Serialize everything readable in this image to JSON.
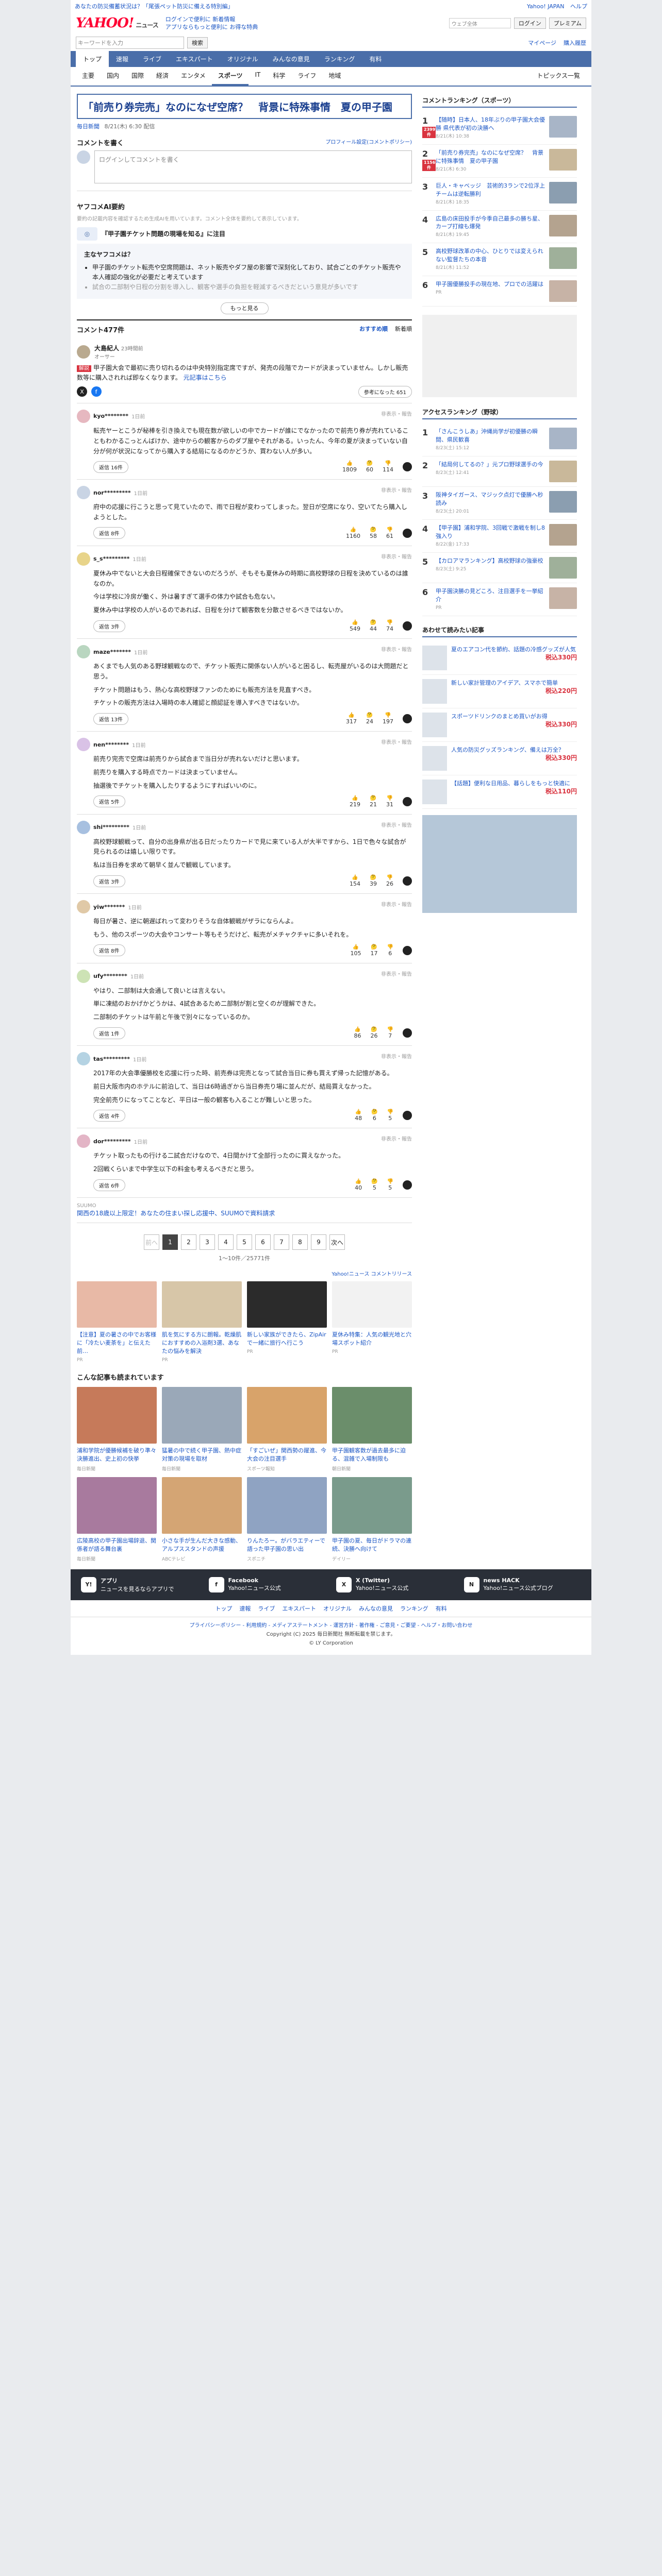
{
  "topbar": {
    "left": "あなたの防災備蓄状況は？「尾張ペット防災に備える特別編」",
    "right_links": [
      "Yahoo! JAPAN",
      "ヘルプ"
    ]
  },
  "header": {
    "logo": "YAHOO!",
    "logo_sub": "ニュース",
    "promo": [
      "ログインで便利に 新着情報",
      "アプリならもっと便利に お得な特典"
    ],
    "search_placeholder": "ウェブ全体",
    "search_button": "ログイン",
    "premium": "プレミアム"
  },
  "search": {
    "placeholder": "キーワードを入力",
    "button": "検索",
    "right": [
      "マイページ",
      "購入履歴"
    ]
  },
  "gnav": [
    "トップ",
    "速報",
    "ライブ",
    "エキスパート",
    "オリジナル",
    "みんなの意見",
    "ランキング",
    "有料"
  ],
  "subnav": [
    "主要",
    "国内",
    "国際",
    "経済",
    "エンタメ",
    "スポーツ",
    "IT",
    "科学",
    "ライフ",
    "地域"
  ],
  "subnav_right": "トピックス一覧",
  "article": {
    "title": "「前売り券完売」なのになぜ空席？　背景に特殊事情　夏の甲子園",
    "source": "毎日新聞",
    "date": "8/21(木) 6:30 配信"
  },
  "compose": {
    "title": "コメントを書く",
    "link": "プロフィール設定(コメントポリシー)",
    "placeholder": "ログインしてコメントを書く"
  },
  "ai": {
    "title": "ヤフコメAI要約",
    "note": "要約の記載内容を確認するため生成AIを用いています。コメント全体を要約して表示しています。",
    "question": "『甲子園チケット問題の現場を知る』に注目",
    "box_title": "主なヤフコメは？",
    "points": [
      "甲子園のチケット転売や空席問題は、ネット販売やダフ屋の影響で深刻化しており、試合ごとのチケット販売や本人確認の強化が必要だと考えています",
      "試合の二部制や日程の分割を導入し、観客や選手の負担を軽減するべきだという意見が多いです"
    ],
    "more": "もっと見る"
  },
  "comments_head": {
    "title": "コメント477件",
    "sort_label": "おすすめ順",
    "sort_alt": "新着順"
  },
  "expert": {
    "name": "大島紀人",
    "role": "オーサー",
    "time": "23時間前",
    "tag": "解説",
    "body": "甲子園大会で最初に売り切れるのは中央特別指定席ですが、発売の段階でカードが決まっていません。しかし販売数等に購入されれば即なくなります。",
    "link": "元記事はこちら",
    "likes": "参考になった 651"
  },
  "comments": [
    {
      "user": "kyo********",
      "time": "1日前",
      "action": "非表示・報告",
      "text": [
        "転売ヤーとこうが秘棒を引き換えでも現在数が欲しいの中でカードが誰にでなかったので前売り券が売れていることもわかるこっとんばけか、途中からの観客からのダブ屋やそれがある。いったん、今年の夏が決まっていない自分が何が状況になってから購入する結局になるのかどうか、買わない人が多い。"
      ],
      "reply": "返信 16件",
      "votes": [
        "1809",
        "60",
        "114"
      ]
    },
    {
      "user": "nor*********",
      "time": "1日前",
      "action": "非表示・報告",
      "text": [
        "府中の応援に行こうと思って見ていたので、雨で日程が変わってしまった。翌日が空席になり、空いてたら購入しようとした。"
      ],
      "reply": "返信 8件",
      "votes": [
        "1160",
        "58",
        "61"
      ]
    },
    {
      "user": "s_s*********",
      "time": "1日前",
      "action": "非表示・報告",
      "text": [
        "夏休み中でないと大会日程確保できないのだろうが、そもそも夏休みの時期に高校野球の日程を決めているのは誰なのか。",
        "今は学校に冷房が働く、外は暑すぎて選手の体力や試合も危ない。",
        "夏休み中は学校の人がいるのであれば、日程を分けて観客数を分散させるべきではないか。"
      ],
      "reply": "返信 3件",
      "votes": [
        "549",
        "44",
        "74"
      ]
    },
    {
      "user": "maze*******",
      "time": "1日前",
      "action": "非表示・報告",
      "text": [
        "あくまでも人気のある野球観戦なので、チケット販売に関係ない人がいると困るし、転売屋がいるのは大問題だと思う。",
        "チケット問題はもう、熱心な高校野球ファンのためにも販売方法を見直すべき。",
        "チケットの販売方法は入場時の本人確認と顔認証を導入すべきではないか。"
      ],
      "reply": "返信 13件",
      "votes": [
        "317",
        "24",
        "197"
      ]
    },
    {
      "user": "nen********",
      "time": "1日前",
      "action": "非表示・報告",
      "text": [
        "前売り完売で空席は前売りから試合まで当日分が売れないだけと思います。",
        "前売りを購入する時点でカードは決まっていません。",
        "抽選後でチケットを購入したりするようにすればいいのに。"
      ],
      "reply": "返信 5件",
      "votes": [
        "219",
        "21",
        "31"
      ]
    },
    {
      "user": "shi*********",
      "time": "1日前",
      "action": "非表示・報告",
      "text": [
        "高校野球観戦って、自分の出身県が出る日だったりカードで見に来ている人が大半ですから、1日で色々な試合が見られるのは嬉しい限りです。",
        "私は当日券を求めて朝早く並んで観戦しています。"
      ],
      "reply": "返信 3件",
      "votes": [
        "154",
        "39",
        "26"
      ]
    },
    {
      "user": "yiw*******",
      "time": "1日前",
      "action": "非表示・報告",
      "text": [
        "毎日が暑さ、逆に朝遅ばれって変わりそうな自体観戦がザラにならんよ。",
        "もう、他のスポーツの大会やコンサート等もそうだけど、転売がメチャクチャに多いそれを。"
      ],
      "reply": "返信 8件",
      "votes": [
        "105",
        "17",
        "6"
      ]
    },
    {
      "user": "ufy********",
      "time": "1日前",
      "action": "非表示・報告",
      "text": [
        "やはり、二部制は大会通して良いとは言えない。",
        "単に凍結のおかげかどうかは、4試合あるため二部制が割と空くのが理解できた。",
        "二部制のチケットは午前と午後で別々になっているのか。"
      ],
      "reply": "返信 1件",
      "votes": [
        "86",
        "26",
        "7"
      ]
    },
    {
      "user": "tas*********",
      "time": "1日前",
      "action": "非表示・報告",
      "text": [
        "2017年の大会準優勝校を応援に行った時、前売券は完売となって試合当日に券も買えず帰った記憶がある。",
        "前日大阪市内のホテルに前泊して、当日は6時過ぎから当日券売り場に並んだが、結局買えなかった。",
        "完全前売りになってことなど、平日は一般の観客も入ることが難しいと思った。"
      ],
      "reply": "返信 4件",
      "votes": [
        "48",
        "6",
        "5"
      ]
    },
    {
      "user": "dor*********",
      "time": "1日前",
      "action": "非表示・報告",
      "text": [
        "チケット取ったもの行ける二試合だけなので、4日間かけて全部行ったのに買えなかった。",
        "2回戦くらいまで中学生以下の料金も考えるべきだと思う。"
      ],
      "reply": "返信 6件",
      "votes": [
        "40",
        "5",
        "5"
      ]
    }
  ],
  "ad_inline": {
    "label": "SUUMO",
    "text": "関西の18歳以上限定！あなたの住まい探し応援中、SUUMOで資料請求"
  },
  "pager": {
    "prev": "前へ",
    "pages": [
      "1",
      "2",
      "3",
      "4",
      "5",
      "6",
      "7",
      "8",
      "9"
    ],
    "next": "次へ",
    "info": "1〜10件／25771件"
  },
  "ad_head": "Yahoo!ニュース コメントリリース",
  "ad_cards": [
    {
      "t": "【注意】夏の暑さの中でお客様に「冷たい麦茶を」と伝えた前…",
      "s": "PR"
    },
    {
      "t": "肌を気にする方に朗報。乾燥肌におすすめの入浴剤3選、あなたの悩みを解決",
      "s": "PR"
    },
    {
      "t": "新しい家族ができたら、ZipAirで一緒に旅行へ行こう",
      "s": "PR"
    },
    {
      "t": "夏休み特集：人気の観光地と穴場スポット紹介",
      "s": "PR"
    }
  ],
  "reco_title": "こんな記事も読まれています",
  "reco": [
    {
      "t": "浦和学院が優勝候補を破り準々決勝進出、史上初の快挙",
      "s": "毎日新聞"
    },
    {
      "t": "猛暑の中で続く甲子園、熱中症対策の現場を取材",
      "s": "毎日新聞"
    },
    {
      "t": "「すごいぜ」関西勢の躍進、今大会の注目選手",
      "s": "スポーツ報知"
    },
    {
      "t": "甲子園観客数が過去最多に迫る、混雑で入場制限も",
      "s": "朝日新聞"
    },
    {
      "t": "広陵高校の甲子園出場辞退、関係者が語る舞台裏",
      "s": "毎日新聞"
    },
    {
      "t": "小さな手が生んだ大きな感動、アルプススタンドの声援",
      "s": "ABCテレビ"
    },
    {
      "t": "りんたろー。がバラエティーで語った甲子園の思い出",
      "s": "スポニチ"
    },
    {
      "t": "甲子園の夏、毎日がドラマの連続、決勝へ向けて",
      "s": "デイリー"
    }
  ],
  "side_rank_title": "コメントランキング（スポーツ）",
  "side_rank": [
    {
      "t": "【随時】日本人、18年ぶりの甲子園大会優勝 県代表が初の決勝へ",
      "s": "8/21(木) 10:38",
      "b": "2399件"
    },
    {
      "t": "「前売り券完売」なのになぜ空席？　背景に特殊事情　夏の甲子園",
      "s": "8/21(木) 6:30",
      "b": "1156件"
    },
    {
      "t": "巨人・キャベッジ　芸術的3ランで2位浮上 チームは逆転勝利",
      "s": "8/21(木) 18:35",
      "b": ""
    },
    {
      "t": "広島の床田投手が今季自己最多の勝ち星、カープ打線も爆発",
      "s": "8/21(木) 19:45",
      "b": ""
    },
    {
      "t": "高校野球改革の中心、ひとりでは変えられない監督たちの本音",
      "s": "8/21(木) 11:52",
      "b": ""
    },
    {
      "t": "甲子園優勝投手の現在地、プロでの活躍は",
      "s": "PR",
      "b": ""
    }
  ],
  "side_access_title": "アクセスランキング（野球）",
  "side_access": [
    {
      "t": "「さんこうしあ」沖縄尚学が初優勝の瞬間、県民歓喜",
      "s": "8/23(土) 15:12"
    },
    {
      "t": "「結局何してるの？」元プロ野球選手の今",
      "s": "8/23(土) 12:41"
    },
    {
      "t": "阪神タイガース、マジック点灯で優勝へ秒読み",
      "s": "8/23(土) 20:01"
    },
    {
      "t": "【甲子園】浦和学院、3回戦で激戦を制し8強入り",
      "s": "8/22(金) 17:33"
    },
    {
      "t": "【カロアマランキング】高校野球の強豪校",
      "s": "8/23(土) 9:25"
    },
    {
      "t": "甲子園決勝の見どころ、注目選手を一挙紹介",
      "s": "PR"
    }
  ],
  "side_ad_title": "あわせて読みたい記事",
  "side_products": [
    {
      "t": "夏のエアコン代を節約、話題の冷感グッズが人気",
      "p": "税込330円"
    },
    {
      "t": "新しい家計管理のアイデア、スマホで簡単",
      "p": "税込220円"
    },
    {
      "t": "スポーツドリンクのまとめ買いがお得",
      "p": "税込330円"
    },
    {
      "t": "人気の防災グッズランキング、備えは万全？",
      "p": "税込330円"
    },
    {
      "t": "【話題】便利な日用品、暮らしをもっと快適に",
      "p": "税込110円"
    }
  ],
  "footer": {
    "apps": [
      {
        "icon": "Y!",
        "t": "アプリ",
        "s": "ニュースを見るならアプリで"
      },
      {
        "icon": "f",
        "t": "Facebook",
        "s": "Yahoo!ニュース公式"
      },
      {
        "icon": "X",
        "t": "X (Twitter)",
        "s": "Yahoo!ニュース公式"
      },
      {
        "icon": "N",
        "t": "news HACK",
        "s": "Yahoo!ニュース公式ブログ"
      }
    ],
    "nav": [
      "トップ",
      "速報",
      "ライブ",
      "エキスパート",
      "オリジナル",
      "みんなの意見",
      "ランキング",
      "有料"
    ],
    "links": "プライバシーポリシー - 利用規約 - メディアステートメント - 運営方針 - 著作権 - ご意見・ご要望 - ヘルプ・お問い合わせ",
    "copy": "Copyright (C) 2025 毎日新聞社 無断転載を禁じます。",
    "corp": "© LY Corporation"
  }
}
